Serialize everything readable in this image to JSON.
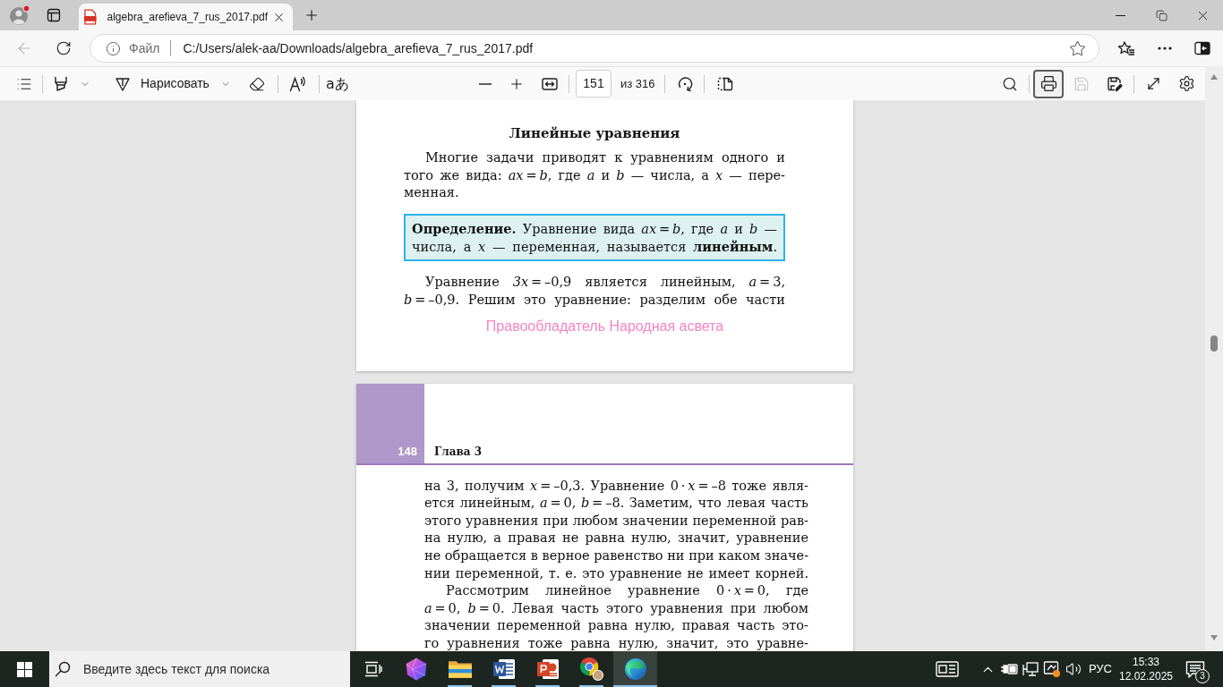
{
  "window": {
    "tabs": [
      {
        "title": "algebra_arefieva_7_rus_2017.pdf",
        "selected": true
      }
    ]
  },
  "navigation": {
    "back_disabled": true,
    "address": {
      "scheme_label": "Файл",
      "url": "C:/Users/alek-aa/Downloads/algebra_arefieva_7_rus_2017.pdf"
    }
  },
  "pdf_toolbar": {
    "draw_label": "Нарисовать",
    "translate_label": "aあ",
    "page_number": "151",
    "page_total": "из 316",
    "right_tool_groups": [
      [
        {
          "kind": "search",
          "selected": false,
          "disabled": false
        }
      ],
      [
        {
          "kind": "print",
          "selected": true,
          "disabled": false
        },
        {
          "kind": "save",
          "selected": false,
          "disabled": true
        },
        {
          "kind": "save_as",
          "selected": false,
          "disabled": false
        }
      ],
      [
        {
          "kind": "fullscreen",
          "selected": false,
          "disabled": false
        },
        {
          "kind": "settings",
          "selected": false,
          "disabled": false
        }
      ]
    ]
  },
  "document": {
    "pages": [
      {
        "title": "Линейные уравнения",
        "blocks": [
          {
            "kind": "paragraph",
            "lines": [
              "Многие задачи приводят к уравнениям одного и",
              "того же вида: *ax* = *b*, где *a* и *b* — числа, а *x* — пере-",
              "менная."
            ]
          },
          {
            "kind": "definition",
            "lines": [
              "**Определение.** Уравнение вида *ax* = *b*, где *a* и *b* —",
              "числа, а *x* — переменная, называется **линейным**."
            ]
          },
          {
            "kind": "paragraph",
            "lines": [
              "Уравнение *3x* = –0,9 является линейным, *a* = 3,",
              "*b* = –0,9. Решим это уравнение: разделим обе части"
            ]
          }
        ],
        "footer": "Правообладатель Народная асвета"
      },
      {
        "header": {
          "page_number": "148",
          "chapter": "Глава 3"
        },
        "blocks": [
          {
            "kind": "continuation",
            "lines": [
              "на 3, получим *x* = –0,3. Уравнение 0 · *x* = –8 тоже явля-",
              "ется линейным, *a* = 0, *b* = –8. Заметим, что левая часть",
              "этого уравнения при любом значении переменной рав-",
              "на нулю, а правая не равна нулю, значит, уравнение",
              "не обращается в верное равенство ни при каком значе-",
              "нии переменной, т. е. это уравнение не имеет корней."
            ]
          },
          {
            "kind": "paragraph",
            "lines": [
              "Рассмотрим линейное уравнение 0 · *x* = 0, где",
              "*a* = 0, *b* = 0. Левая часть этого уравнения при любом",
              "значении переменной равна нулю, правая часть это-",
              "го уравнения тоже равна нулю, значит, это уравне-"
            ]
          }
        ]
      }
    ]
  },
  "taskbar": {
    "search": {
      "placeholder": "Введите здесь текст для поиска"
    },
    "apps": [
      {
        "kind": "gem",
        "running": false,
        "selected": false
      },
      {
        "kind": "folder",
        "running": true,
        "selected": false
      },
      {
        "kind": "word",
        "running": true,
        "selected": false
      },
      {
        "kind": "slides",
        "running": true,
        "selected": false
      },
      {
        "kind": "chrome",
        "running": true,
        "selected": false
      },
      {
        "kind": "edge",
        "running": true,
        "selected": true
      }
    ],
    "tray": {
      "language": "РУС",
      "time": "15:33",
      "date": "12.02.2025",
      "notification_count": "3"
    }
  }
}
